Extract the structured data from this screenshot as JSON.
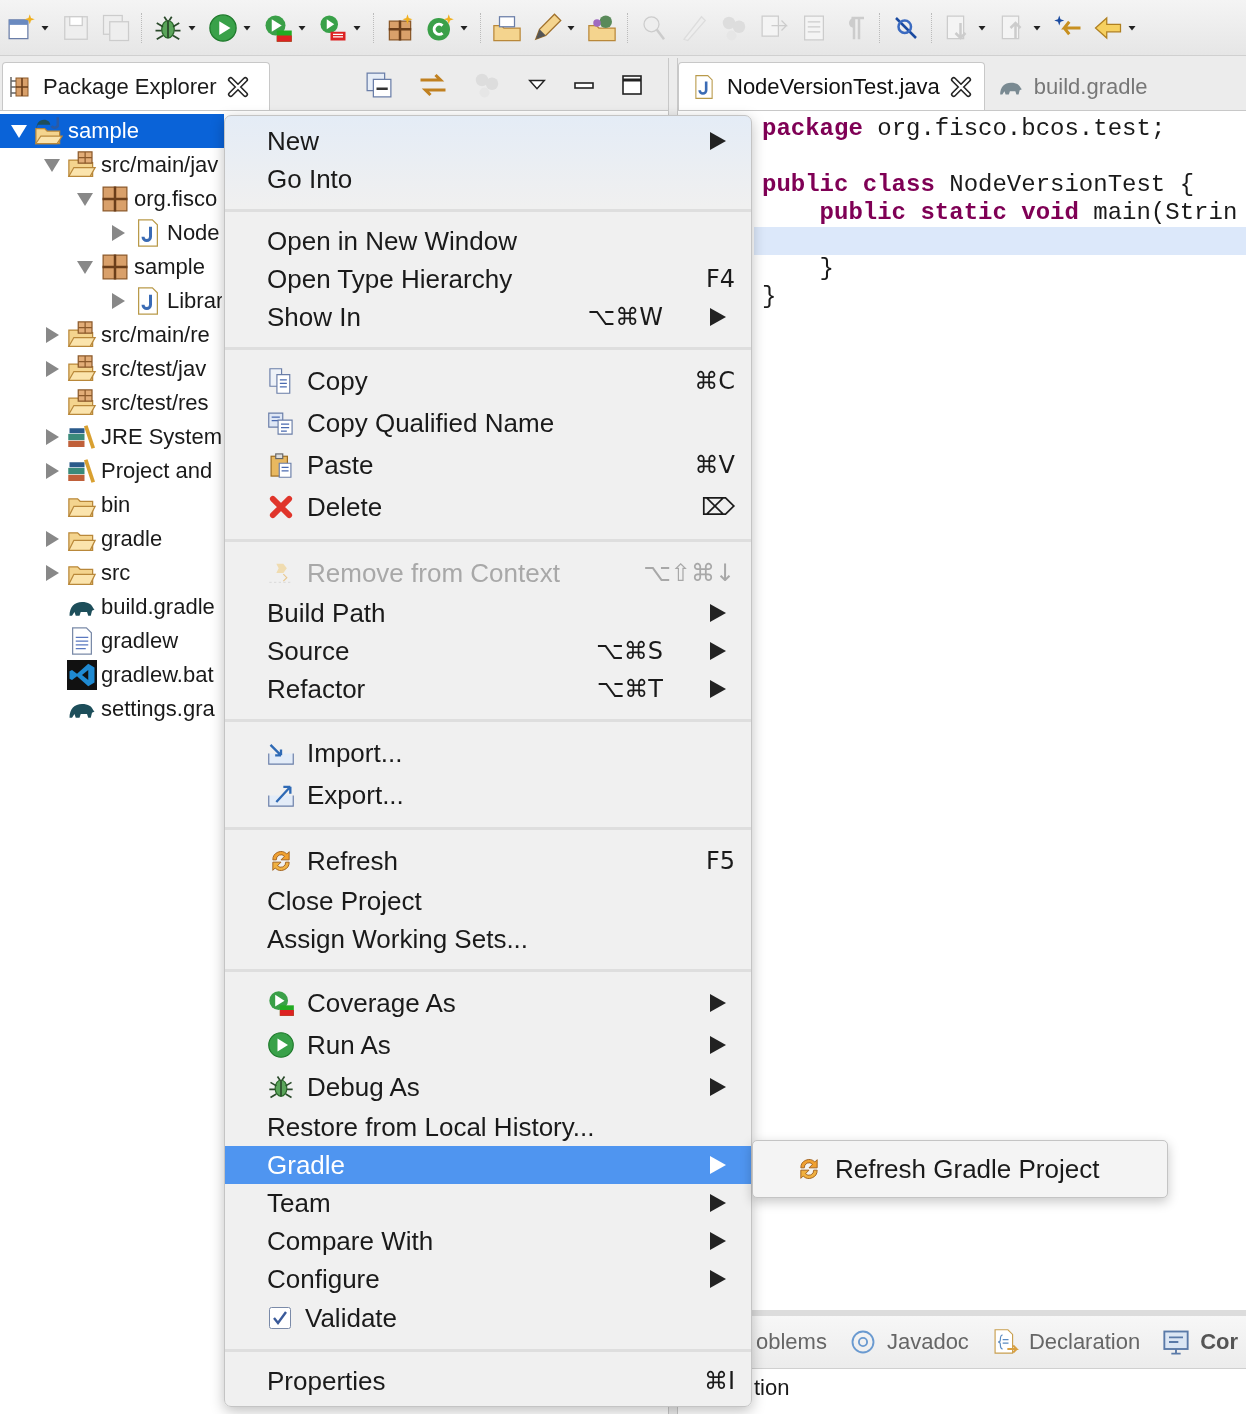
{
  "explorer": {
    "tab": {
      "label": "Package Explorer",
      "selected": true
    },
    "tree": [
      {
        "label": "sample",
        "selected": true,
        "expanded": true,
        "children": [
          {
            "label": "src/main/jav",
            "selected": false,
            "expanded": true,
            "children": [
              {
                "label": "org.fisco",
                "selected": false,
                "expanded": true,
                "children": [
                  {
                    "label": "Node",
                    "selected": false,
                    "expanded": false
                  }
                ]
              },
              {
                "label": "sample",
                "selected": false,
                "expanded": true,
                "children": [
                  {
                    "label": "Librar",
                    "selected": false,
                    "expanded": false
                  }
                ]
              }
            ]
          },
          {
            "label": "src/main/re",
            "selected": false,
            "expanded": false
          },
          {
            "label": "src/test/jav",
            "selected": false,
            "expanded": false
          },
          {
            "label": "src/test/res",
            "selected": false
          },
          {
            "label": "JRE System",
            "selected": false,
            "expanded": false
          },
          {
            "label": "Project and",
            "selected": false,
            "expanded": false
          },
          {
            "label": "bin",
            "selected": false
          },
          {
            "label": "gradle",
            "selected": false,
            "expanded": false
          },
          {
            "label": "src",
            "selected": false,
            "expanded": false
          },
          {
            "label": "build.gradle",
            "selected": false
          },
          {
            "label": "gradlew",
            "selected": false
          },
          {
            "label": "gradlew.bat",
            "selected": false
          },
          {
            "label": "settings.gra",
            "selected": false
          }
        ]
      }
    ]
  },
  "editor": {
    "tabs": [
      {
        "label": "NodeVersionTest.java",
        "selected": true
      },
      {
        "label": "build.gradle",
        "selected": false
      }
    ],
    "lines": [
      {
        "current": false,
        "segments": [
          {
            "kind": "keyword",
            "text": "package"
          },
          {
            "kind": "plain",
            "text": " org.fisco.bcos.test;"
          }
        ]
      },
      {
        "current": false
      },
      {
        "current": false,
        "segments": [
          {
            "kind": "keyword",
            "text": "public class"
          },
          {
            "kind": "plain",
            "text": " NodeVersionTest {"
          }
        ]
      },
      {
        "current": false,
        "segments": [
          {
            "kind": "keyword",
            "text": "    public static void"
          },
          {
            "kind": "plain",
            "text": " main(Strin"
          }
        ]
      },
      {
        "current": true
      },
      {
        "current": false,
        "segments": [
          {
            "kind": "plain",
            "text": "    }"
          }
        ]
      },
      {
        "current": false,
        "segments": [
          {
            "kind": "plain",
            "text": "}"
          }
        ]
      }
    ]
  },
  "bottom_panel": {
    "tabs": [
      {
        "label": "oblems",
        "selected": false
      },
      {
        "label": "Javadoc",
        "selected": false
      },
      {
        "label": "Declaration",
        "selected": false
      },
      {
        "label": "Cor",
        "selected": true
      }
    ],
    "content": "tion"
  },
  "context_menu": {
    "items": [
      {
        "kind": "item",
        "label": "New",
        "submenu": true,
        "disabled": false,
        "selected": false
      },
      {
        "kind": "item",
        "label": "Go Into",
        "submenu": false,
        "disabled": false,
        "selected": false
      },
      {
        "kind": "separator"
      },
      {
        "kind": "item",
        "label": "Open in New Window",
        "submenu": false,
        "disabled": false,
        "selected": false
      },
      {
        "kind": "item",
        "label": "Open Type Hierarchy",
        "shortcut": "F4",
        "submenu": false,
        "disabled": false,
        "selected": false
      },
      {
        "kind": "item",
        "label": "Show In",
        "shortcut": "⌥⌘W",
        "submenu": true,
        "disabled": false,
        "selected": false
      },
      {
        "kind": "separator"
      },
      {
        "kind": "item",
        "label": "Copy",
        "shortcut": "⌘C",
        "submenu": false,
        "disabled": false,
        "selected": false
      },
      {
        "kind": "item",
        "label": "Copy Qualified Name",
        "submenu": false,
        "disabled": false,
        "selected": false
      },
      {
        "kind": "item",
        "label": "Paste",
        "shortcut": "⌘V",
        "submenu": false,
        "disabled": false,
        "selected": false
      },
      {
        "kind": "item",
        "label": "Delete",
        "shortcut": "⌦",
        "submenu": false,
        "disabled": false,
        "selected": false
      },
      {
        "kind": "separator"
      },
      {
        "kind": "item",
        "label": "Remove from Context",
        "shortcut": "⌥⇧⌘↓",
        "submenu": false,
        "disabled": true,
        "selected": false
      },
      {
        "kind": "item",
        "label": "Build Path",
        "submenu": true,
        "disabled": false,
        "selected": false
      },
      {
        "kind": "item",
        "label": "Source",
        "shortcut": "⌥⌘S",
        "submenu": true,
        "disabled": false,
        "selected": false
      },
      {
        "kind": "item",
        "label": "Refactor",
        "shortcut": "⌥⌘T",
        "submenu": true,
        "disabled": false,
        "selected": false
      },
      {
        "kind": "separator"
      },
      {
        "kind": "item",
        "label": "Import...",
        "submenu": false,
        "disabled": false,
        "selected": false
      },
      {
        "kind": "item",
        "label": "Export...",
        "submenu": false,
        "disabled": false,
        "selected": false
      },
      {
        "kind": "separator"
      },
      {
        "kind": "item",
        "label": "Refresh",
        "shortcut": "F5",
        "submenu": false,
        "disabled": false,
        "selected": false
      },
      {
        "kind": "item",
        "label": "Close Project",
        "submenu": false,
        "disabled": false,
        "selected": false
      },
      {
        "kind": "item",
        "label": "Assign Working Sets...",
        "submenu": false,
        "disabled": false,
        "selected": false
      },
      {
        "kind": "separator"
      },
      {
        "kind": "item",
        "label": "Coverage As",
        "submenu": true,
        "disabled": false,
        "selected": false
      },
      {
        "kind": "item",
        "label": "Run As",
        "submenu": true,
        "disabled": false,
        "selected": false
      },
      {
        "kind": "item",
        "label": "Debug As",
        "submenu": true,
        "disabled": false,
        "selected": false
      },
      {
        "kind": "item",
        "label": "Restore from Local History...",
        "submenu": false,
        "disabled": false,
        "selected": false
      },
      {
        "kind": "item",
        "label": "Gradle",
        "submenu": true,
        "disabled": false,
        "selected": true
      },
      {
        "kind": "item",
        "label": "Team",
        "submenu": true,
        "disabled": false,
        "selected": false
      },
      {
        "kind": "item",
        "label": "Compare With",
        "submenu": true,
        "disabled": false,
        "selected": false
      },
      {
        "kind": "item",
        "label": "Configure",
        "submenu": true,
        "disabled": false,
        "selected": false
      },
      {
        "kind": "checkbox",
        "label": "Validate",
        "checked": true,
        "submenu": false,
        "disabled": false,
        "selected": false
      },
      {
        "kind": "separator"
      },
      {
        "kind": "item",
        "label": "Properties",
        "shortcut": "⌘I",
        "submenu": false,
        "disabled": false,
        "selected": false
      }
    ]
  },
  "submenu": {
    "items": [
      {
        "label": "Refresh Gradle Project",
        "selected": false
      }
    ]
  }
}
